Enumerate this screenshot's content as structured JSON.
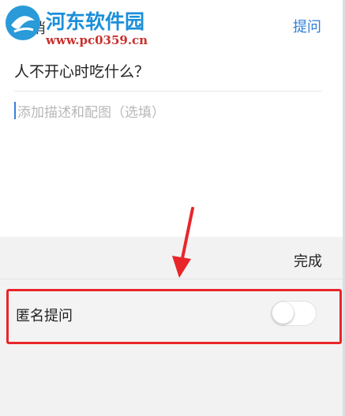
{
  "header": {
    "cancel_label": "取消",
    "ask_label": "提问"
  },
  "watermark": {
    "site_name": "河东软件园",
    "url": "www.pc0359.cn"
  },
  "question": {
    "title": "人不开心时吃什么？",
    "description_placeholder": "添加描述和配图（选填）"
  },
  "toolbar": {
    "done_label": "完成"
  },
  "anonymous": {
    "label": "匿名提问",
    "enabled": false
  },
  "colors": {
    "accent": "#2f7fd6",
    "annotation": "#e8262a"
  }
}
